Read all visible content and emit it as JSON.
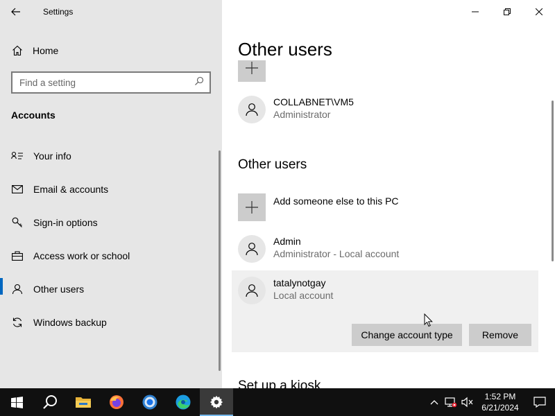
{
  "window": {
    "title": "Settings"
  },
  "nav": {
    "home_label": "Home",
    "search_placeholder": "Find a setting",
    "section_title": "Accounts",
    "items": [
      {
        "label": "Your info",
        "icon": "person-card-icon"
      },
      {
        "label": "Email & accounts",
        "icon": "mail-icon"
      },
      {
        "label": "Sign-in options",
        "icon": "key-icon"
      },
      {
        "label": "Access work or school",
        "icon": "briefcase-icon"
      },
      {
        "label": "Other users",
        "icon": "people-icon",
        "selected": true
      },
      {
        "label": "Windows backup",
        "icon": "sync-icon"
      }
    ]
  },
  "content": {
    "page_title": "Other users",
    "top_user": {
      "name": "COLLABNET\\VM5",
      "role": "Administrator"
    },
    "section_heading": "Other users",
    "add_label": "Add someone else to this PC",
    "users": [
      {
        "name": "Admin",
        "role": "Administrator - Local account"
      },
      {
        "name": "tatalynotgay",
        "role": "Local account",
        "selected": true
      }
    ],
    "actions": {
      "change_type": "Change account type",
      "remove": "Remove"
    },
    "next_section": "Set up a kiosk"
  },
  "taskbar": {
    "time": "1:52 PM",
    "date": "6/21/2024",
    "apps": [
      "windows-start-icon",
      "search-icon",
      "file-explorer-icon",
      "firefox-icon",
      "chrome-icon",
      "edge-icon",
      "settings-gear-icon"
    ]
  },
  "colors": {
    "accent": "#0067c0",
    "sidebar_bg": "#e6e6e6",
    "taskbar_bg": "#101010"
  }
}
